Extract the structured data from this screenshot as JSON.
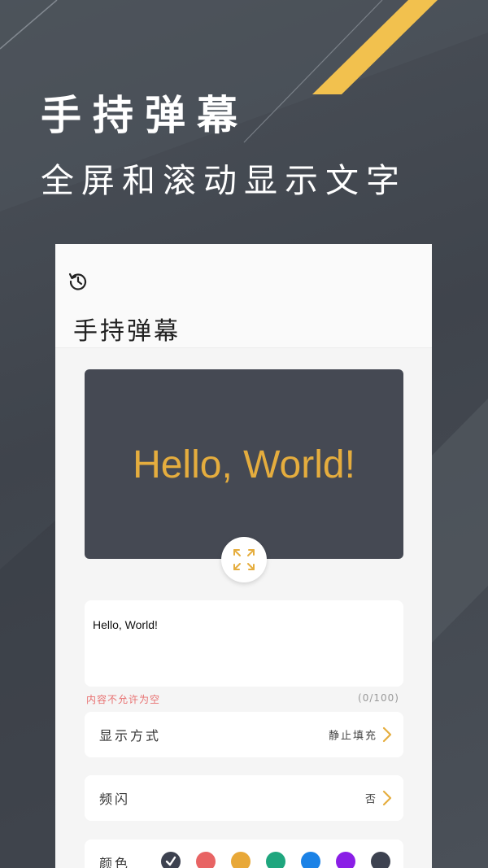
{
  "promo": {
    "title": "手持弹幕",
    "subtitle": "全屏和滚动显示文字"
  },
  "app": {
    "history_icon": "history-icon",
    "title": "手持弹幕",
    "preview": {
      "text": "Hello, World!",
      "background": "#454953",
      "text_color": "#e5ad3e"
    },
    "fullscreen_icon": "expand-icon",
    "input": {
      "value": "Hello, World!"
    },
    "validation": {
      "error": "内容不允许为空",
      "count": "(0/100)"
    },
    "settings": [
      {
        "label": "显示方式",
        "value": "静止填充"
      },
      {
        "label": "频闪",
        "value": "否"
      }
    ],
    "color": {
      "label": "颜色",
      "swatches": [
        {
          "name": "dark-gray",
          "hex": "#3d4250",
          "selected": true
        },
        {
          "name": "red",
          "hex": "#e86464",
          "selected": false
        },
        {
          "name": "orange",
          "hex": "#e8a838",
          "selected": false
        },
        {
          "name": "green",
          "hex": "#1fa67e",
          "selected": false
        },
        {
          "name": "blue",
          "hex": "#1b82e6",
          "selected": false
        },
        {
          "name": "purple",
          "hex": "#8a1ee6",
          "selected": false
        },
        {
          "name": "slate",
          "hex": "#3d4250",
          "selected": false
        }
      ]
    }
  },
  "colors": {
    "accent": "#f2c14e",
    "background": "#464b53"
  }
}
